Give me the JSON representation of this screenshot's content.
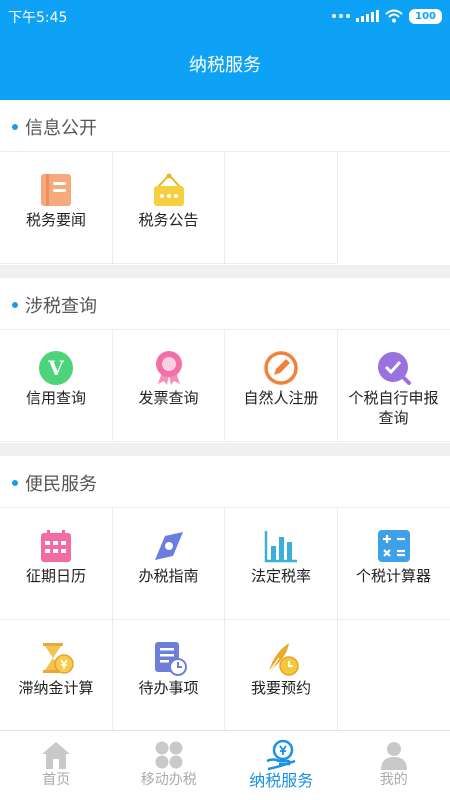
{
  "status": {
    "time": "下午5:45",
    "battery": "100"
  },
  "header": {
    "title": "纳税服务"
  },
  "sections": [
    {
      "title": "信息公开",
      "items": [
        {
          "label": "税务要闻"
        },
        {
          "label": "税务公告"
        }
      ]
    },
    {
      "title": "涉税查询",
      "items": [
        {
          "label": "信用查询"
        },
        {
          "label": "发票查询"
        },
        {
          "label": "自然人注册"
        },
        {
          "label": "个税自行申报查询"
        }
      ]
    },
    {
      "title": "便民服务",
      "items": [
        {
          "label": "征期日历"
        },
        {
          "label": "办税指南"
        },
        {
          "label": "法定税率"
        },
        {
          "label": "个税计算器"
        },
        {
          "label": "滞纳金计算"
        },
        {
          "label": "待办事项"
        },
        {
          "label": "我要预约"
        }
      ]
    }
  ],
  "tabs": [
    {
      "label": "首页"
    },
    {
      "label": "移动办税"
    },
    {
      "label": "纳税服务"
    },
    {
      "label": "我的"
    }
  ],
  "credit_icon_glyph": "V",
  "colors": {
    "primary": "#0da2f6",
    "active_tab": "#1a90e8"
  }
}
